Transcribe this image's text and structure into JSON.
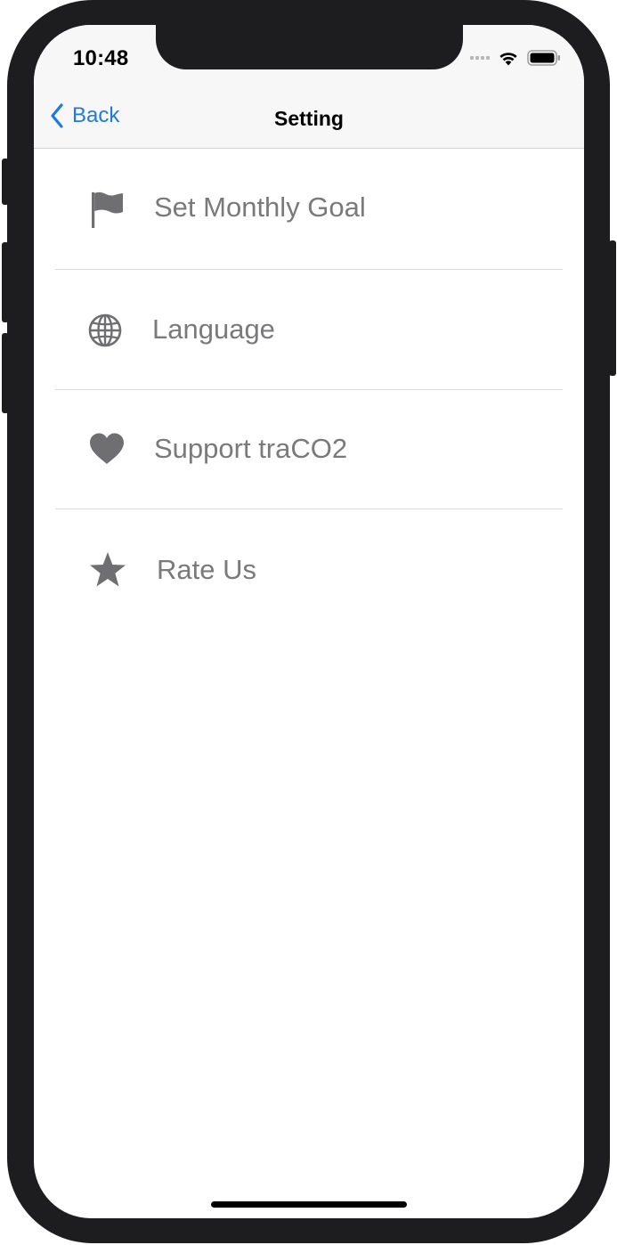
{
  "status_bar": {
    "time": "10:48"
  },
  "nav": {
    "back_label": "Back",
    "title": "Setting"
  },
  "menu": {
    "items": [
      {
        "icon": "flag-icon",
        "label": "Set Monthly Goal"
      },
      {
        "icon": "globe-icon",
        "label": "Language"
      },
      {
        "icon": "heart-icon",
        "label": "Support traCO2"
      },
      {
        "icon": "star-icon",
        "label": "Rate Us"
      }
    ]
  },
  "colors": {
    "accent": "#1e7bdc",
    "item_text": "#7a7a7c",
    "icon": "#6f6f71",
    "bar_background": "#f7f7f7"
  }
}
